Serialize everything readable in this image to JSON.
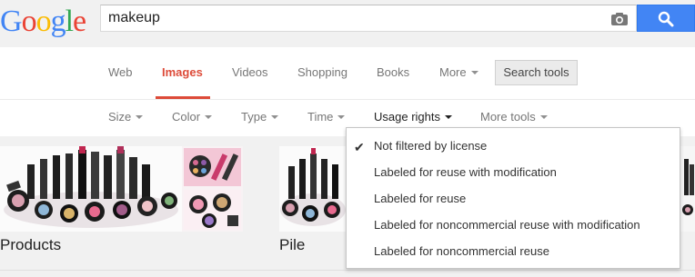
{
  "logo": {
    "letters": [
      {
        "char": "G",
        "color": "#4285f4"
      },
      {
        "char": "o",
        "color": "#ea4335"
      },
      {
        "char": "o",
        "color": "#fbbc05"
      },
      {
        "char": "g",
        "color": "#4285f4"
      },
      {
        "char": "l",
        "color": "#34a853"
      },
      {
        "char": "e",
        "color": "#ea4335"
      }
    ]
  },
  "search": {
    "query": "makeup"
  },
  "nav": {
    "web": "Web",
    "images": "Images",
    "videos": "Videos",
    "shopping": "Shopping",
    "books": "Books",
    "more": "More",
    "search_tools": "Search tools"
  },
  "tools": {
    "size": "Size",
    "color": "Color",
    "type": "Type",
    "time": "Time",
    "usage_rights": "Usage rights",
    "more_tools": "More tools"
  },
  "usage_menu": {
    "items": [
      "Not filtered by license",
      "Labeled for reuse with modification",
      "Labeled for reuse",
      "Labeled for noncommercial reuse with modification",
      "Labeled for noncommercial reuse"
    ],
    "selected_index": 0
  },
  "results": {
    "labels": [
      "Products",
      "Pile"
    ]
  },
  "colors": {
    "accent_red": "#dd4b39",
    "search_blue": "#4285f4"
  }
}
